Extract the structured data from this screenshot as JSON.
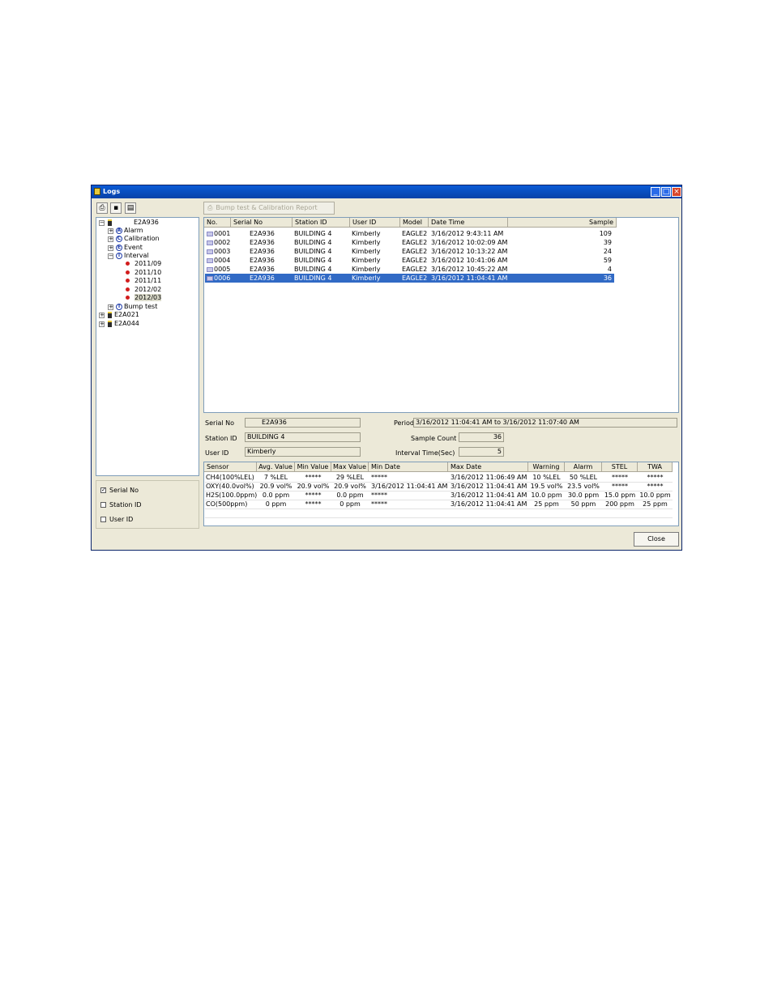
{
  "window": {
    "title": "Logs"
  },
  "toolbar": {
    "print": "print-icon",
    "save": "save-icon",
    "clipboard": "clipboard-icon",
    "bump_report": "Bump test & Calibration Report"
  },
  "tree": {
    "root": "E2A936",
    "alarm": "Alarm",
    "calibration": "Calibration",
    "event": "Event",
    "interval": "Interval",
    "months": [
      "2011/09",
      "2011/10",
      "2011/11",
      "2012/02",
      "2012/03"
    ],
    "bump": "Bump test",
    "dev2": "E2A021",
    "dev3": "E2A044"
  },
  "filters": {
    "serial": "Serial No",
    "station": "Station ID",
    "user": "User ID",
    "serial_checked": true
  },
  "logs": {
    "headers": [
      "No.",
      "Serial No",
      "Station ID",
      "User ID",
      "Model",
      "Date Time",
      "Sample"
    ],
    "rows": [
      {
        "no": "0001",
        "serial": "E2A936",
        "station": "BUILDING 4",
        "user": "Kimberly",
        "model": "EAGLE2",
        "datetime": "3/16/2012 9:43:11 AM",
        "sample": "109"
      },
      {
        "no": "0002",
        "serial": "E2A936",
        "station": "BUILDING 4",
        "user": "Kimberly",
        "model": "EAGLE2",
        "datetime": "3/16/2012 10:02:09 AM",
        "sample": "39"
      },
      {
        "no": "0003",
        "serial": "E2A936",
        "station": "BUILDING 4",
        "user": "Kimberly",
        "model": "EAGLE2",
        "datetime": "3/16/2012 10:13:22 AM",
        "sample": "24"
      },
      {
        "no": "0004",
        "serial": "E2A936",
        "station": "BUILDING 4",
        "user": "Kimberly",
        "model": "EAGLE2",
        "datetime": "3/16/2012 10:41:06 AM",
        "sample": "59"
      },
      {
        "no": "0005",
        "serial": "E2A936",
        "station": "BUILDING 4",
        "user": "Kimberly",
        "model": "EAGLE2",
        "datetime": "3/16/2012 10:45:22 AM",
        "sample": "4"
      },
      {
        "no": "0006",
        "serial": "E2A936",
        "station": "BUILDING 4",
        "user": "Kimberly",
        "model": "EAGLE2",
        "datetime": "3/16/2012 11:04:41 AM",
        "sample": "36"
      }
    ],
    "selected_row": "0006"
  },
  "info": {
    "serial_label": "Serial No",
    "serial_value": "E2A936",
    "station_label": "Station ID",
    "station_value": "BUILDING 4",
    "user_label": "User ID",
    "user_value": "Kimberly",
    "period_label": "Period",
    "period_value": "3/16/2012 11:04:41 AM to 3/16/2012 11:07:40 AM",
    "count_label": "Sample Count",
    "count_value": "36",
    "interval_label": "Interval Time(Sec)",
    "interval_value": "5"
  },
  "sensors": {
    "headers": [
      "Sensor",
      "Avg. Value",
      "Min Value",
      "Max Value",
      "Min Date",
      "Max Date",
      "Warning",
      "Alarm",
      "STEL",
      "TWA"
    ],
    "rows": [
      [
        "CH4(100%LEL)",
        "7 %LEL",
        "*****",
        "29 %LEL",
        "*****",
        "3/16/2012 11:06:49 AM",
        "10 %LEL",
        "50 %LEL",
        "*****",
        "*****"
      ],
      [
        "OXY(40.0vol%)",
        "20.9 vol%",
        "20.9 vol%",
        "20.9 vol%",
        "3/16/2012 11:04:41 AM",
        "3/16/2012 11:04:41 AM",
        "19.5 vol%",
        "23.5 vol%",
        "*****",
        "*****"
      ],
      [
        "H2S(100.0ppm)",
        "0.0 ppm",
        "*****",
        "0.0 ppm",
        "*****",
        "3/16/2012 11:04:41 AM",
        "10.0 ppm",
        "30.0 ppm",
        "15.0 ppm",
        "10.0 ppm"
      ],
      [
        "CO(500ppm)",
        "0 ppm",
        "*****",
        "0 ppm",
        "*****",
        "3/16/2012 11:04:41 AM",
        "25 ppm",
        "50 ppm",
        "200 ppm",
        "25 ppm"
      ]
    ]
  },
  "footer": {
    "close": "Close"
  }
}
